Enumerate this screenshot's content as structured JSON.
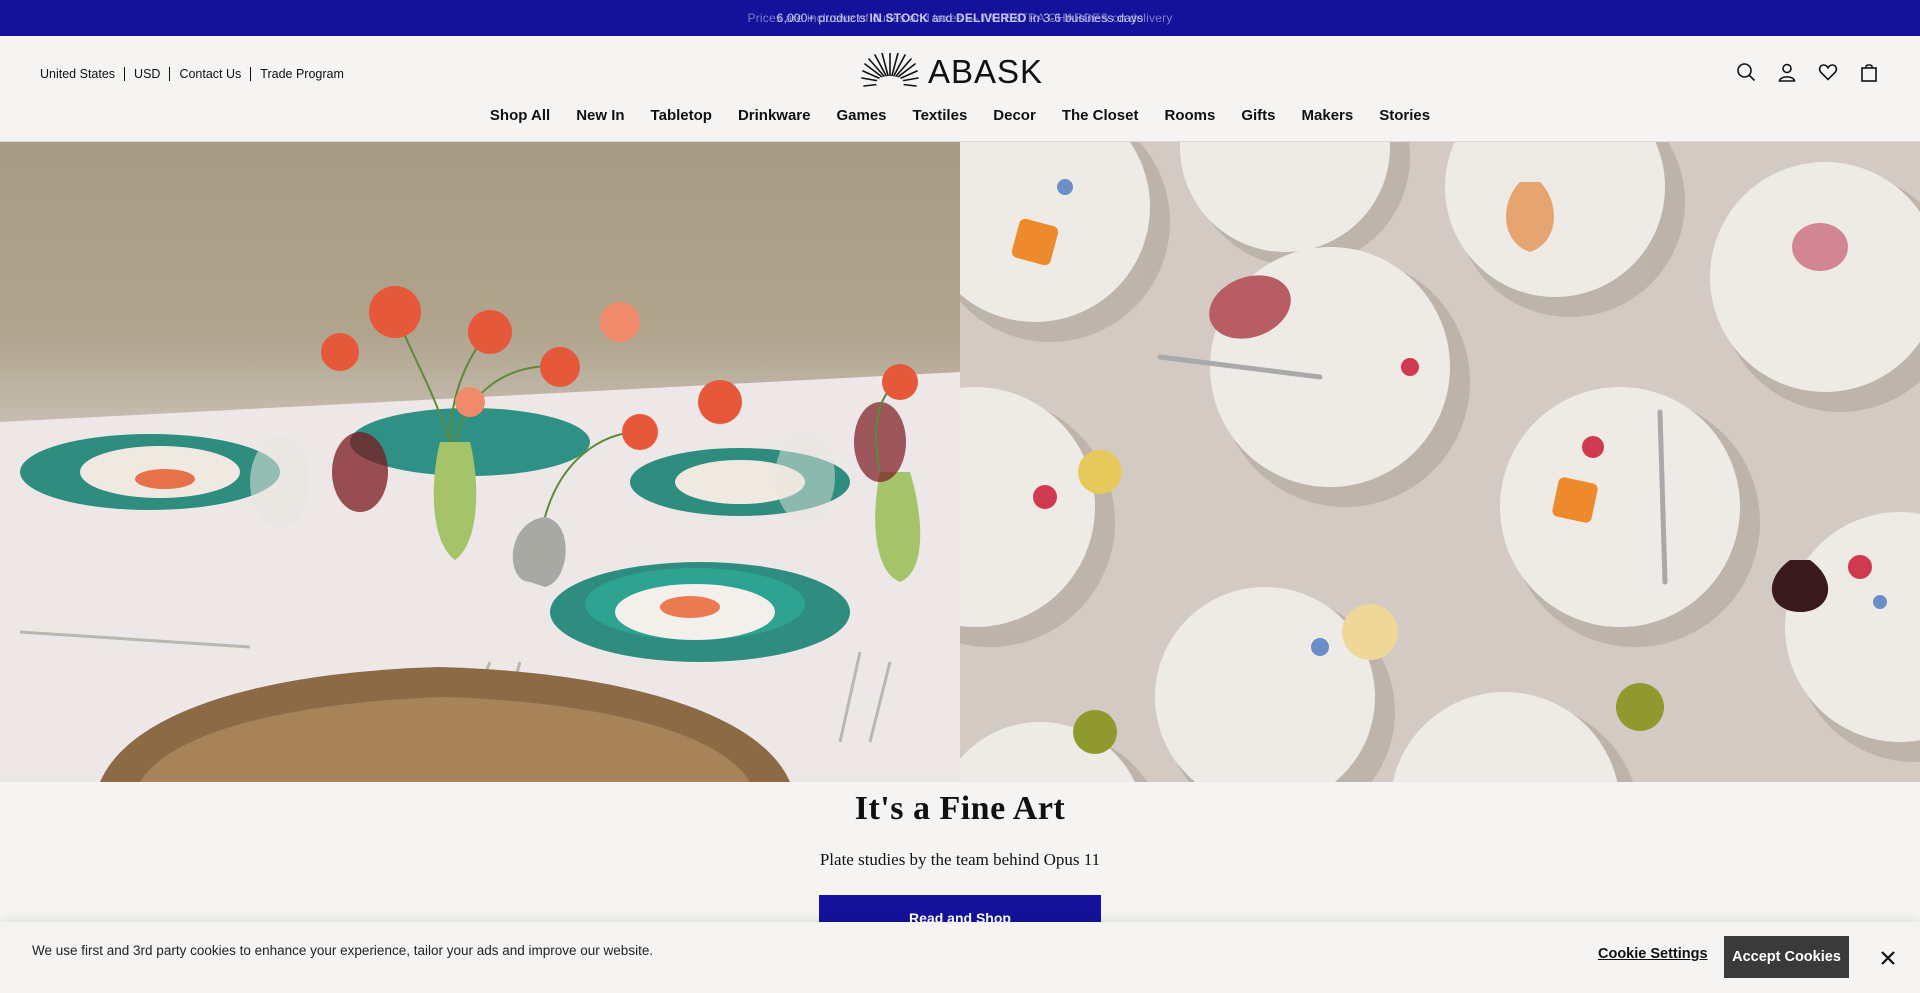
{
  "announcement": {
    "back_text": "Prices are inclusive of duties and taxes — NO EXTRA CHARGES on delivery",
    "front_pre": "6,000+ products ",
    "front_bold1": "IN STOCK",
    "front_mid": " and ",
    "front_bold2": "DELIVERED",
    "front_post": " in 3-6 business days"
  },
  "utility": {
    "country": "United States",
    "currency": "USD",
    "contact": "Contact Us",
    "trade": "Trade Program"
  },
  "brand": {
    "name": "ABASK"
  },
  "header_icons": [
    "search-icon",
    "account-icon",
    "wishlist-heart-icon",
    "shopping-bag-icon"
  ],
  "nav": [
    "Shop All",
    "New In",
    "Tabletop",
    "Drinkware",
    "Games",
    "Textiles",
    "Decor",
    "The Closet",
    "Rooms",
    "Gifts",
    "Makers",
    "Stories"
  ],
  "hero": {
    "title": "It's a Fine Art",
    "subtitle": "Plate studies by the team behind Opus 11",
    "cta": "Read and Shop"
  },
  "cookie": {
    "text": "We use first and 3rd party cookies to enhance your experience, tailor your ads and improve our website.",
    "settings": "Cookie Settings",
    "accept": "Accept Cookies"
  },
  "colors": {
    "accent": "#14129b",
    "accept_button": "#3a3a3a",
    "background": "#f5f4f2"
  }
}
